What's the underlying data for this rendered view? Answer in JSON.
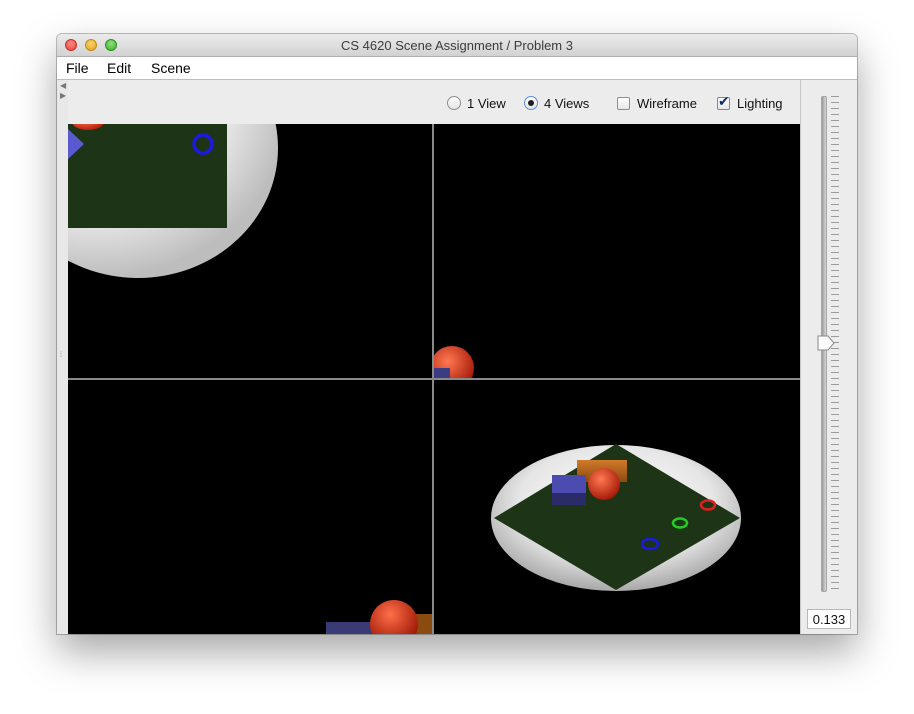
{
  "window": {
    "title": "CS 4620 Scene Assignment / Problem 3"
  },
  "menu": {
    "items": [
      "File",
      "Edit",
      "Scene"
    ]
  },
  "toolbar": {
    "view_one_label": "1 View",
    "view_four_label": "4 Views",
    "wireframe_label": "Wireframe",
    "lighting_label": "Lighting",
    "selected_view": "4 Views",
    "wireframe_checked": false,
    "lighting_checked": true
  },
  "slider": {
    "value_text": "0.133",
    "level_fraction": 0.5
  },
  "icons": {
    "collapse_left": "triangle-left-icon",
    "collapse_right": "triangle-right-icon",
    "split_handle": "grip-icon"
  },
  "colors": {
    "floor": "#1d3417",
    "sphere": "#e03b22",
    "box_blue": "#4a4aa8",
    "box_orange": "#b05a10",
    "torus_red": "#e02020",
    "torus_green": "#22cc22",
    "torus_blue": "#1a1ae0",
    "focus": "#5c8fd6"
  }
}
